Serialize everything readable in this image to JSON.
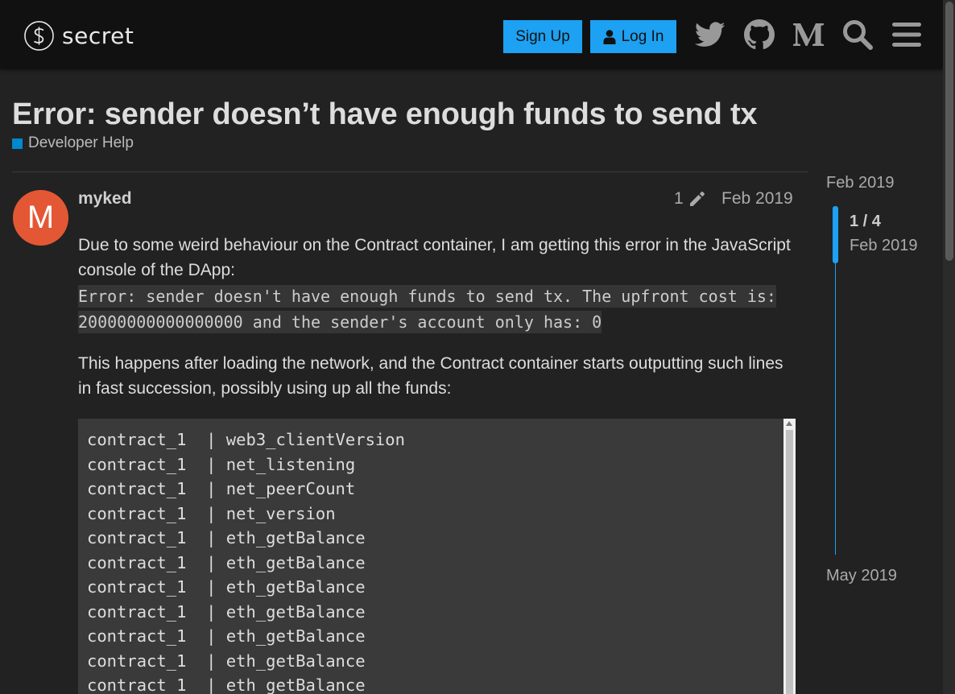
{
  "header": {
    "logo_text": "secret",
    "signup_label": "Sign Up",
    "login_label": "Log In",
    "icons": [
      "twitter-icon",
      "github-icon",
      "medium-icon",
      "search-icon",
      "hamburger-menu-icon"
    ],
    "accent_color": "#1da1f2"
  },
  "topic": {
    "title": "Error: sender doesn’t have enough funds to send tx",
    "category": "Developer Help",
    "category_color": "#0088cc"
  },
  "post": {
    "avatar_letter": "M",
    "avatar_color": "#e45735",
    "username": "myked",
    "edit_count": "1",
    "date": "Feb 2019",
    "paragraph1": "Due to some weird behaviour on the Contract container, I am getting this error in the JavaScript console of the DApp:",
    "error_code": "Error: sender doesn't have enough funds to send tx. The upfront cost is: 20000000000000000 and the sender's account only has: 0",
    "paragraph2": "This happens after loading the network, and the Contract container starts outputting such lines in fast succession, possibly using up all the funds:",
    "code_lines": [
      "contract_1  | web3_clientVersion",
      "contract_1  | net_listening",
      "contract_1  | net_peerCount",
      "contract_1  | net_version",
      "contract_1  | eth_getBalance",
      "contract_1  | eth_getBalance",
      "contract_1  | eth_getBalance",
      "contract_1  | eth_getBalance",
      "contract_1  | eth_getBalance",
      "contract_1  | eth_getBalance",
      "contract_1  | eth_getBalance"
    ]
  },
  "timeline": {
    "start_date": "Feb 2019",
    "position": "1 / 4",
    "position_date": "Feb 2019",
    "end_date": "May 2019"
  }
}
